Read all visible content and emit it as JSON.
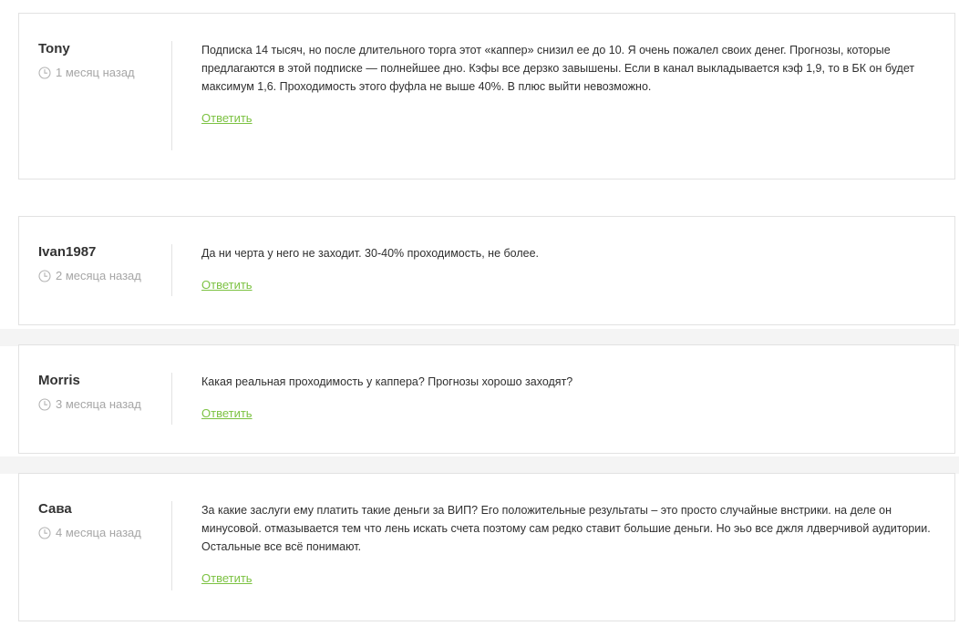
{
  "comments": [
    {
      "author": "Tony",
      "time": "1 месяц назад",
      "text": "Подписка 14 тысяч, но после длительного торга этот «каппер» снизил ее до 10. Я очень пожалел своих денег. Прогнозы, которые предлагаются в этой подписке — полнейшее дно. Кэфы все дерзко завышены. Если в канал выкладывается кэф 1,9, то в БК он будет максимум 1,6. Проходимость этого фуфла не выше 40%. В плюс выйти невозможно.",
      "reply": "Ответить"
    },
    {
      "author": "Ivan1987",
      "time": "2 месяца назад",
      "text": "Да ни черта у него не заходит. 30-40% проходимость, не более.",
      "reply": "Ответить"
    },
    {
      "author": "Morris",
      "time": "3 месяца назад",
      "text": "Какая реальная проходимость у каппера? Прогнозы хорошо заходят?",
      "reply": "Ответить"
    },
    {
      "author": "Сава",
      "time": "4 месяца назад",
      "text": "За какие заслуги ему платить такие деньги за ВИП? Его положительные результаты – это просто случайные внстрики. на деле он минусовой. отмазывается тем что лень искать счета поэтому сам редко ставит большие деньги. Но эьо все джля лдверчивой аудитории. Остальные все всё понимают.",
      "reply": "Ответить"
    }
  ],
  "icons": {
    "clock": "clock-icon"
  },
  "colors": {
    "reply_link": "#7cc242",
    "meta_text": "#a6a6a6",
    "band_background": "#f4f4f4",
    "card_border": "#e2e2e2"
  }
}
